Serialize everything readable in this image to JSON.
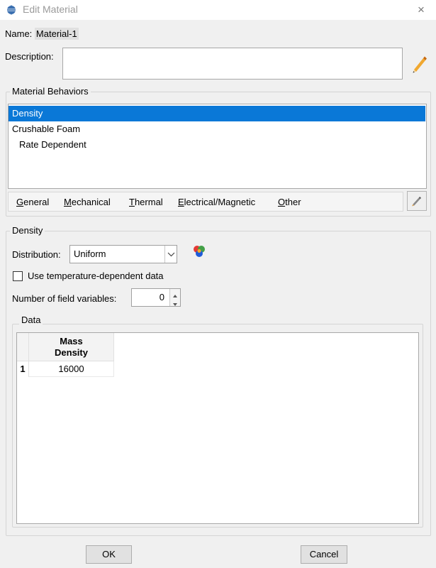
{
  "window": {
    "title": "Edit Material",
    "close_glyph": "×"
  },
  "name": {
    "label": "Name:",
    "value": "Material-1"
  },
  "description": {
    "label": "Description:",
    "value": ""
  },
  "behaviors": {
    "title": "Material Behaviors",
    "items": [
      {
        "label": "Density",
        "selected": true
      },
      {
        "label": "Crushable Foam",
        "selected": false
      },
      {
        "label": "Rate Dependent",
        "selected": false
      }
    ],
    "menu": [
      {
        "label": "General",
        "mnemonic": "G"
      },
      {
        "label": "Mechanical",
        "mnemonic": "M"
      },
      {
        "label": "Thermal",
        "mnemonic": "T"
      },
      {
        "label": "Electrical/Magnetic",
        "mnemonic": "E"
      },
      {
        "label": "Other",
        "mnemonic": "O"
      }
    ]
  },
  "density": {
    "title": "Density",
    "distribution_label": "Distribution:",
    "distribution_value": "Uniform",
    "temp_checkbox_label": "Use temperature-dependent data",
    "temp_checked": false,
    "field_vars_label": "Number of field variables:",
    "field_vars_value": "0"
  },
  "data": {
    "title": "Data",
    "columns": [
      {
        "line1": "Mass",
        "line2": "Density"
      }
    ],
    "rows": [
      {
        "num": "1",
        "values": [
          "16000"
        ]
      }
    ]
  },
  "buttons": {
    "ok": "OK",
    "cancel": "Cancel"
  },
  "colors": {
    "selection": "#0a78d7",
    "background": "#f0f0f0"
  }
}
